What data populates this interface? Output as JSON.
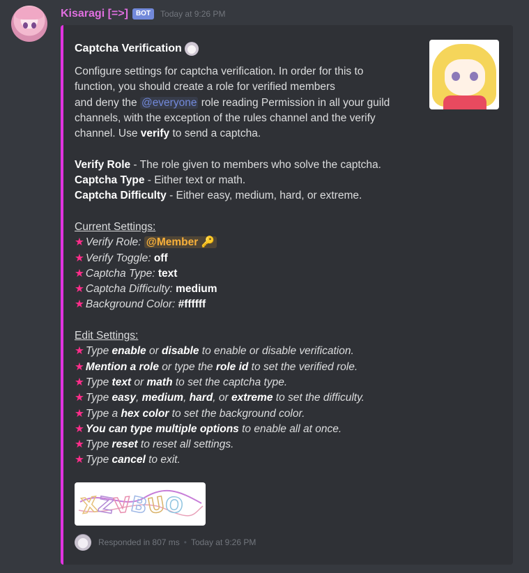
{
  "message": {
    "username": "Kisaragi [=>]",
    "bot_tag": "BOT",
    "timestamp": "Today at 9:26 PM"
  },
  "embed": {
    "accent_color": "#e233e0",
    "title": "Captcha Verification",
    "intro_1": "Configure settings for captcha verification. In order for this to",
    "intro_2": "function, you should create a role for verified members",
    "intro_3a": "and deny the ",
    "intro_3_mention": "@everyone",
    "intro_3b": " role reading Permission in all your guild",
    "intro_4": "channels, with the exception of the rules channel and the verify",
    "intro_5a": "channel. Use ",
    "intro_5_cmd": "verify",
    "intro_5b": " to send a captcha.",
    "fields": [
      {
        "name": "Verify Role",
        "text": " - The role given to members who solve the captcha."
      },
      {
        "name": "Captcha Type",
        "text": " - Either text or math."
      },
      {
        "name": "Captcha Difficulty",
        "text": " - Either easy, medium, hard, or extreme."
      }
    ],
    "current_heading": "Current Settings:",
    "settings": {
      "verify_role_label": "Verify Role: ",
      "verify_role_value": "@Member",
      "verify_toggle_label": "Verify Toggle: ",
      "verify_toggle_value": "off",
      "captcha_type_label": "Captcha Type: ",
      "captcha_type_value": "text",
      "captcha_difficulty_label": "Captcha Difficulty: ",
      "captcha_difficulty_value": "medium",
      "background_color_label": "Background Color: ",
      "background_color_value": "#ffffff"
    },
    "edit_heading": "Edit Settings:",
    "edit": {
      "l1": [
        "Type ",
        "enable",
        " or ",
        "disable",
        " to enable or disable verification."
      ],
      "l2": [
        "Mention a role",
        " or type the ",
        "role id",
        " to set the verified role."
      ],
      "l3": [
        "Type ",
        "text",
        " or ",
        "math",
        " to set the captcha type."
      ],
      "l4": [
        "Type ",
        "easy",
        ", ",
        "medium",
        ", ",
        "hard",
        ", or ",
        "extreme",
        " to set the difficulty."
      ],
      "l5": [
        "Type a ",
        "hex color",
        " to set the background color."
      ],
      "l6": [
        "You can type multiple options",
        " to enable all at once."
      ],
      "l7": [
        "Type ",
        "reset",
        " to reset all settings."
      ],
      "l8": [
        "Type ",
        "cancel",
        " to exit."
      ]
    },
    "captcha_image_text": "XZVBUO",
    "footer": {
      "text": "Responded in 807 ms",
      "timestamp": "Today at 9:26 PM"
    }
  },
  "colors": {
    "star": "#ff2d8b",
    "username": "#e06fe0",
    "role_mention": "#f8b03a",
    "mention": "#7289da"
  }
}
